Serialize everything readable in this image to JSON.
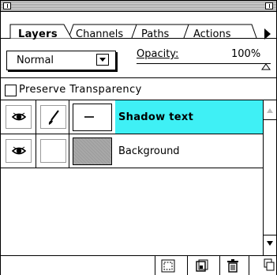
{
  "palette": {
    "tabs": [
      {
        "label": "Layers",
        "active": true
      },
      {
        "label": "Channels",
        "active": false
      },
      {
        "label": "Paths",
        "active": false
      },
      {
        "label": "Actions",
        "active": false
      }
    ],
    "menu_arrow_icon": "triangle-right-icon"
  },
  "controls": {
    "blend_mode": "Normal",
    "opacity_label": "Opacity:",
    "opacity_value": "100%",
    "preserve_transparency_label": "Preserve Transparency",
    "preserve_transparency_checked": false
  },
  "layers": [
    {
      "name": "Shadow text",
      "visible": true,
      "brush": true,
      "selected": true
    },
    {
      "name": "Background",
      "visible": true,
      "brush": false,
      "selected": false
    }
  ],
  "colors": {
    "selection": "#3ff0f5"
  },
  "toolbar": {
    "icons": [
      "selection-to-mask-icon",
      "new-layer-icon",
      "trash-icon"
    ]
  }
}
